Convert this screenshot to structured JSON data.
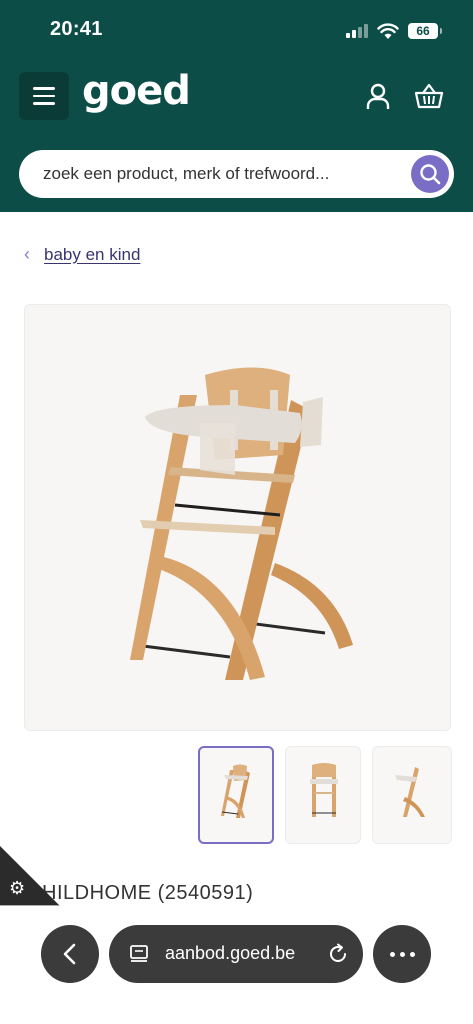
{
  "status_bar": {
    "time": "20:41",
    "battery": "66"
  },
  "header": {
    "logo": "goed",
    "icons": [
      "menu-icon",
      "account-icon",
      "basket-icon"
    ]
  },
  "search": {
    "placeholder": "zoek een product, merk of trefwoord..."
  },
  "breadcrumb": {
    "link": "baby en kind"
  },
  "product": {
    "title_partial": "HILDHOME (2540591)",
    "thumbnail_count": 3,
    "active_thumbnail": 1
  },
  "browser": {
    "url": "aanbod.goed.be"
  },
  "colors": {
    "header_bg": "#0d4d47",
    "accent": "#7a6dc6",
    "browser_pill": "#3b3b3b"
  }
}
